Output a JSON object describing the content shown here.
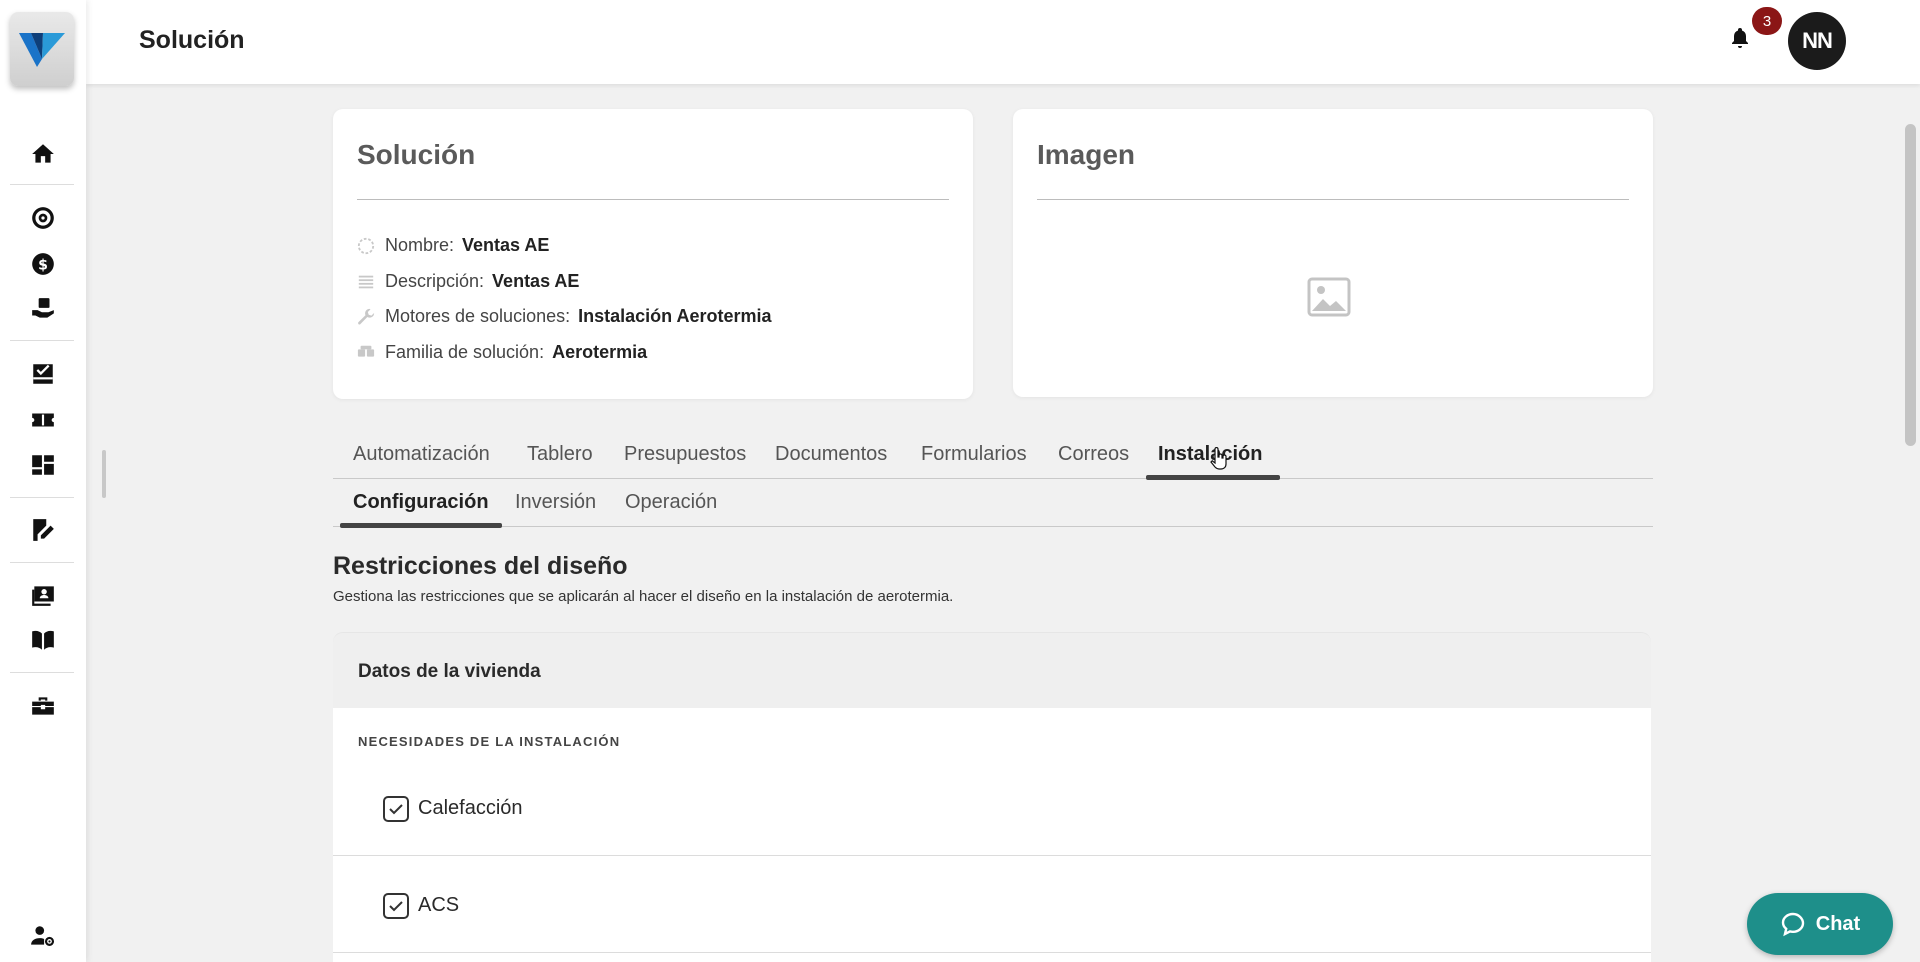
{
  "header": {
    "title": "Solución",
    "notification_count": "3",
    "avatar_initials": "NN"
  },
  "sidebar": {
    "icons": [
      "home-icon",
      "target-icon",
      "dollar-icon",
      "hand-box-icon",
      "check-tray-icon",
      "ticket-icon",
      "dashboard-icon",
      "edit-doc-icon",
      "id-card-icon",
      "book-icon",
      "toolbox-icon",
      "user-gear-icon"
    ]
  },
  "solution_card": {
    "title": "Solución",
    "rows": [
      {
        "label": "Nombre:",
        "value": "Ventas AE",
        "icon": "circle-dashed-icon"
      },
      {
        "label": "Descripción:",
        "value": "Ventas AE",
        "icon": "lines-icon"
      },
      {
        "label": "Motores de soluciones:",
        "value": "Instalación Aerotermia",
        "icon": "wrench-icon"
      },
      {
        "label": "Familia de solución:",
        "value": "Aerotermia",
        "icon": "boxes-icon"
      }
    ]
  },
  "image_card": {
    "title": "Imagen"
  },
  "tabs": [
    {
      "label": "Automatización"
    },
    {
      "label": "Tablero"
    },
    {
      "label": "Presupuestos"
    },
    {
      "label": "Documentos"
    },
    {
      "label": "Formularios"
    },
    {
      "label": "Correos"
    },
    {
      "label": "Instalación",
      "active": true
    }
  ],
  "subtabs": [
    {
      "label": "Configuración",
      "active": true
    },
    {
      "label": "Inversión"
    },
    {
      "label": "Operación"
    }
  ],
  "section": {
    "title": "Restricciones del diseño",
    "description": "Gestiona las restricciones que se aplicarán al hacer el diseño en la instalación de aerotermia."
  },
  "panel": {
    "title": "Datos de la vivienda",
    "group_label": "NECESIDADES DE LA INSTALACIÓN",
    "options": [
      {
        "label": "Calefacción",
        "checked": true
      },
      {
        "label": "ACS",
        "checked": true
      }
    ]
  },
  "chat": {
    "label": "Chat"
  },
  "colors": {
    "accent": "#1e8f8a",
    "badge": "#8b1616",
    "avatar": "#1b1b1b"
  }
}
